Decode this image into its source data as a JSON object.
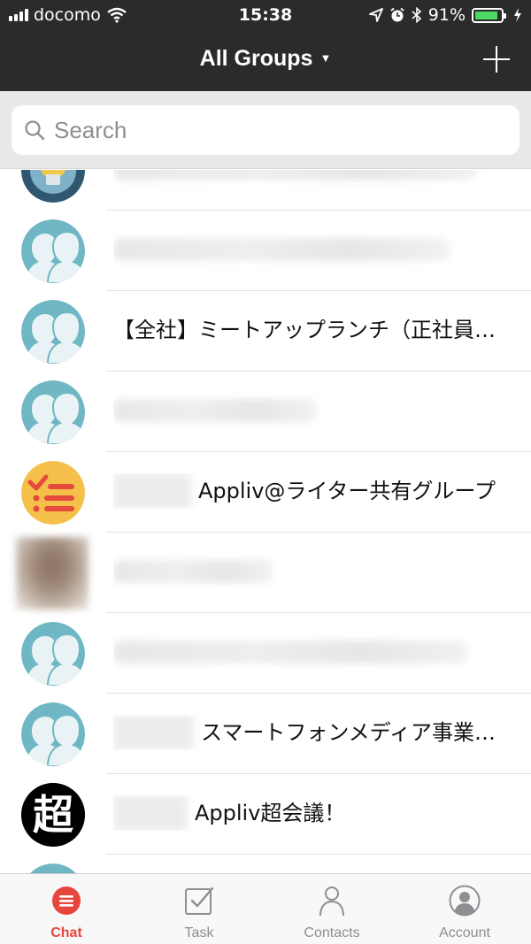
{
  "status_bar": {
    "carrier": "docomo",
    "time": "15:38",
    "battery_percent": "91%",
    "battery_level": 0.91,
    "icons": [
      "signal-bars-icon",
      "wifi-icon",
      "location-arrow-icon",
      "alarm-icon",
      "bluetooth-icon",
      "battery-icon",
      "charging-bolt-icon"
    ]
  },
  "header": {
    "title": "All Groups",
    "dropdown_icon": "caret-down-icon",
    "add_icon": "plus-icon"
  },
  "search": {
    "placeholder": "Search",
    "icon": "magnifier-icon"
  },
  "groups": [
    {
      "avatar": "lightbulb-avatar",
      "name": "",
      "blurred": true
    },
    {
      "avatar": "default-group-avatar",
      "name": "",
      "blurred": true
    },
    {
      "avatar": "default-group-avatar",
      "name": "【全社】ミートアップランチ（正社員…",
      "blurred": false
    },
    {
      "avatar": "default-group-avatar",
      "name": "",
      "blurred": true
    },
    {
      "avatar": "checklist-avatar",
      "name": "Appliv@ライター共有グループ",
      "blurred": false,
      "blurred_prefix": true
    },
    {
      "avatar": "photo-avatar",
      "name": "",
      "blurred": true
    },
    {
      "avatar": "default-group-avatar",
      "name": "",
      "blurred": true
    },
    {
      "avatar": "default-group-avatar",
      "name": "スマートフォンメディア事業…",
      "blurred": false,
      "blurred_prefix": true
    },
    {
      "avatar": "kanji-avatar",
      "avatar_char": "超",
      "name": "Appliv超会議！",
      "blurred": false,
      "blurred_prefix": true
    },
    {
      "avatar": "default-group-avatar",
      "name": "",
      "blurred": true
    }
  ],
  "tabs": [
    {
      "label": "Chat",
      "icon": "chat-bubble-icon",
      "active": true
    },
    {
      "label": "Task",
      "icon": "task-checkbox-icon",
      "active": false
    },
    {
      "label": "Contacts",
      "icon": "contacts-person-icon",
      "active": false
    },
    {
      "label": "Account",
      "icon": "account-circle-icon",
      "active": false
    }
  ],
  "colors": {
    "header_bg": "#2b2b2b",
    "accent": "#e8453c",
    "avatar_teal": "#6fb7c4",
    "battery_green": "#4cd964",
    "tab_inactive": "#8e8e93"
  }
}
